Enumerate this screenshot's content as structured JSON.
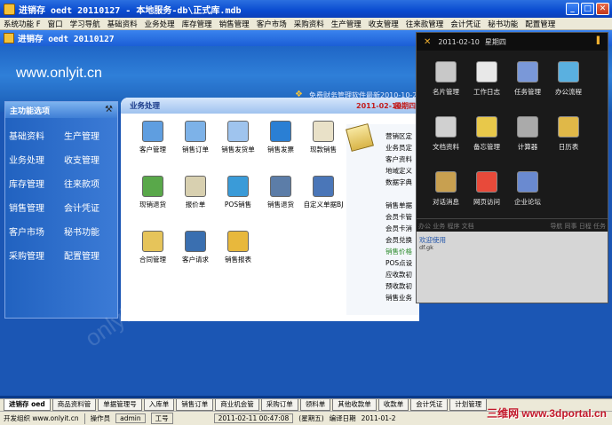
{
  "window": {
    "title": "进销存 oedt 20110127 - 本地服务-db\\正式库.mdb"
  },
  "menubar": [
    "系统功能 F",
    "窗口",
    "学习导航",
    "基础资料",
    "业务处理",
    "库存管理",
    "销售管理",
    "客户市场",
    "采购资料",
    "生产管理",
    "收支管理",
    "往来款管理",
    "会计凭证",
    "秘书功能",
    "配置管理"
  ],
  "inner": {
    "title": "进销存 oedt 20110127",
    "site": "www.onlyit.cn",
    "promo": "免费财务管理软件最新2010-10-2"
  },
  "side_menu": {
    "header": "主功能选项",
    "items": [
      "基础资料",
      "生产管理",
      "业务处理",
      "收支管理",
      "库存管理",
      "往来款项",
      "销售管理",
      "会计凭证",
      "客户市场",
      "秘书功能",
      "采购管理",
      "配置管理"
    ]
  },
  "panel": {
    "title": "业务处理",
    "date": "2011-02-10",
    "week": "星期四",
    "functions": [
      {
        "label": "客户管理",
        "color": "#5f9ee0"
      },
      {
        "label": "销售订单",
        "color": "#7db2e8"
      },
      {
        "label": "销售发货单",
        "color": "#9fc4ee"
      },
      {
        "label": "销售发票",
        "color": "#2a7fd4"
      },
      {
        "label": "现款销售",
        "color": "#e9e1c8"
      },
      {
        "label": "现销退货",
        "color": "#59a84a"
      },
      {
        "label": "报价单",
        "color": "#d8d0b0"
      },
      {
        "label": "POS销售",
        "color": "#3a9bd8"
      },
      {
        "label": "销售退货",
        "color": "#5c7da8"
      },
      {
        "label": "自定义单据BJ",
        "color": "#4a76b8"
      },
      {
        "label": "合同管理",
        "color": "#e6c45a"
      },
      {
        "label": "客户请求",
        "color": "#3a6fb0"
      },
      {
        "label": "销售报表",
        "color": "#e8b83c"
      }
    ],
    "right_list": [
      "营销区定",
      "业务员定",
      "客户资料",
      "地域定义",
      "数据字典",
      "",
      "销售单据",
      "会员卡管",
      "会员卡消",
      "会员兑换",
      "销售价格",
      "POS点设",
      "应收款初",
      "预收款初",
      "销售业务"
    ]
  },
  "overlay": {
    "date": "2011-02-10",
    "week": "星期四",
    "functions": [
      {
        "label": "名片管理",
        "color": "#c8c8c8"
      },
      {
        "label": "工作日志",
        "color": "#e8e8e8"
      },
      {
        "label": "任务管理",
        "color": "#7a98d8"
      },
      {
        "label": "办公流程",
        "color": "#5ab0e0"
      },
      {
        "label": "文档资料",
        "color": "#d0d0d0"
      },
      {
        "label": "备忘管理",
        "color": "#e8c84a"
      },
      {
        "label": "计算器",
        "color": "#aaaaaa"
      },
      {
        "label": "日历表",
        "color": "#e0b848"
      },
      {
        "label": "对话消息",
        "color": "#c8a050"
      },
      {
        "label": "网页访问",
        "color": "#e84a3a"
      },
      {
        "label": "企业论坛",
        "color": "#6a8ad0"
      }
    ],
    "nav_left": "办公 业务 程序 文档",
    "nav_right": "导航 同事 日程 任务",
    "welcome": "欢迎使用",
    "sub": "df.gk"
  },
  "watermark": "onlyIT.cn",
  "tabs": [
    "进销存 oed",
    "商品资料管",
    "单据管理号",
    "入库单",
    "销售订单",
    "商业机会管",
    "采购订单",
    "领料单",
    "其他收款单",
    "收款单",
    "会计凭证",
    "计划管理"
  ],
  "status": {
    "org": "开发组织 www.onlyit.cn",
    "operator_label": "操作员",
    "operator": "admin",
    "job_label": "工号",
    "datetime": "2011-02-11 00:47:08",
    "weekday": "(星期五)",
    "compile_label": "编译日期",
    "compile_date": "2011-01-2"
  },
  "portal_mark": "三维网 www.3dportal.cn"
}
